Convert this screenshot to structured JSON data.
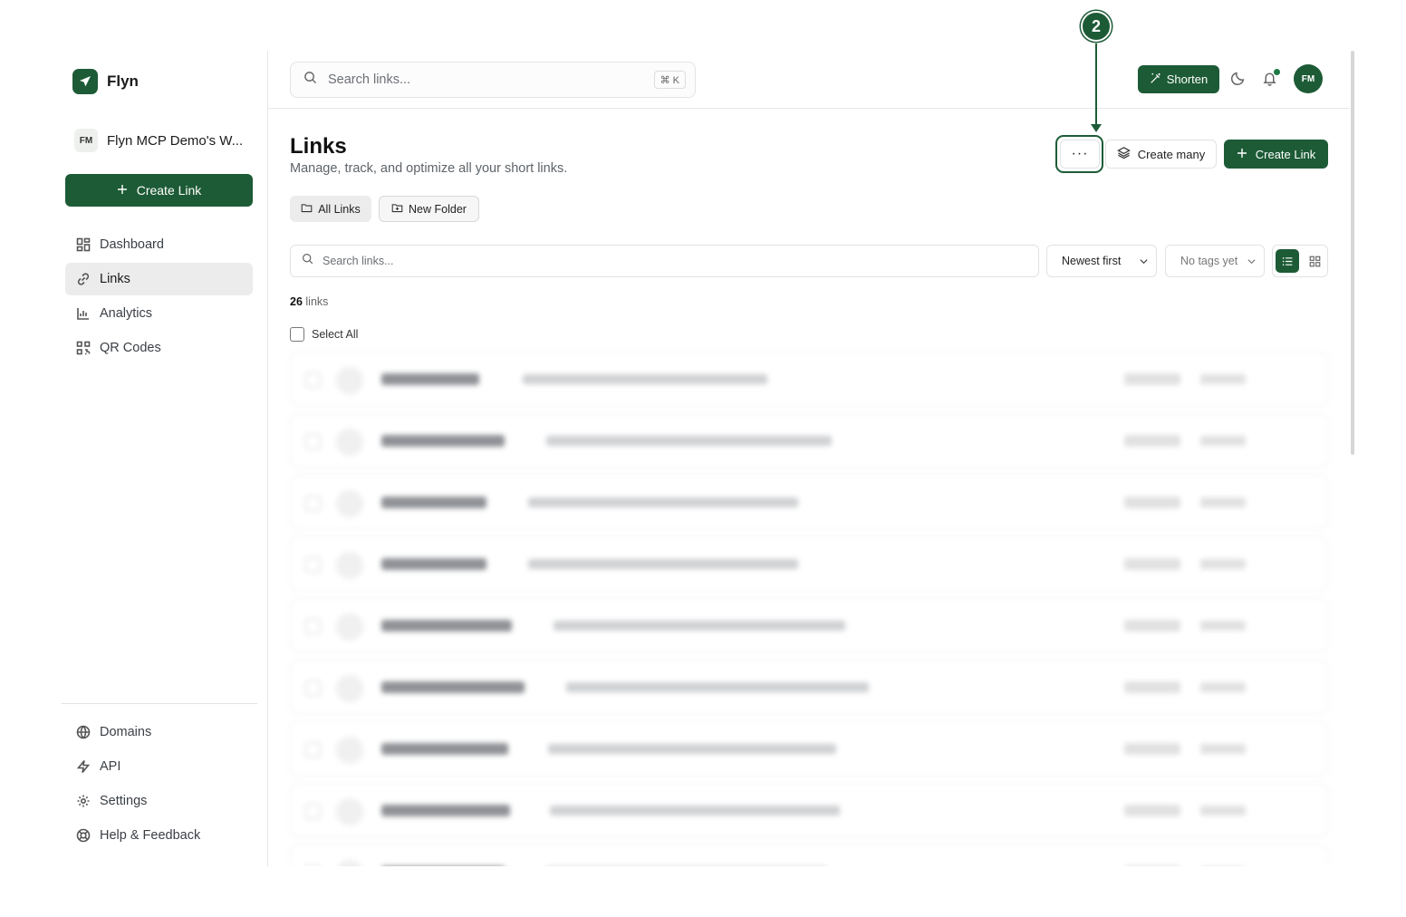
{
  "sidebar": {
    "brand": "Flyn",
    "workspace": {
      "avatar": "FM",
      "name": "Flyn MCP Demo's W..."
    },
    "create_label": "Create Link",
    "nav": [
      {
        "label": "Dashboard",
        "icon": "dashboard-icon"
      },
      {
        "label": "Links",
        "icon": "link-icon",
        "active": true
      },
      {
        "label": "Analytics",
        "icon": "bar-chart-icon"
      },
      {
        "label": "QR Codes",
        "icon": "qr-code-icon"
      }
    ],
    "nav_bottom": [
      {
        "label": "Domains",
        "icon": "globe-icon"
      },
      {
        "label": "API",
        "icon": "lightning-icon"
      },
      {
        "label": "Settings",
        "icon": "gear-icon"
      },
      {
        "label": "Help & Feedback",
        "icon": "lifebuoy-icon"
      }
    ]
  },
  "topbar": {
    "search_placeholder": "Search links...",
    "shortcut": "⌘ K",
    "shorten_label": "Shorten",
    "user_avatar": "FM"
  },
  "main": {
    "title": "Links",
    "subtitle": "Manage, track, and optimize all your short links.",
    "more_label": "···",
    "create_many_label": "Create many",
    "create_link_label": "Create Link",
    "folders": {
      "all": "All Links",
      "new": "New Folder"
    },
    "search_placeholder": "Search links...",
    "sort_value": "Newest first",
    "tags_value": "No tags yet",
    "count_number": "26",
    "count_suffix": "links",
    "select_all_label": "Select All"
  },
  "annotation": {
    "step": "2"
  },
  "colors": {
    "accent": "#1d5b36",
    "border": "#e4e4e4",
    "muted": "#6b6f75"
  }
}
